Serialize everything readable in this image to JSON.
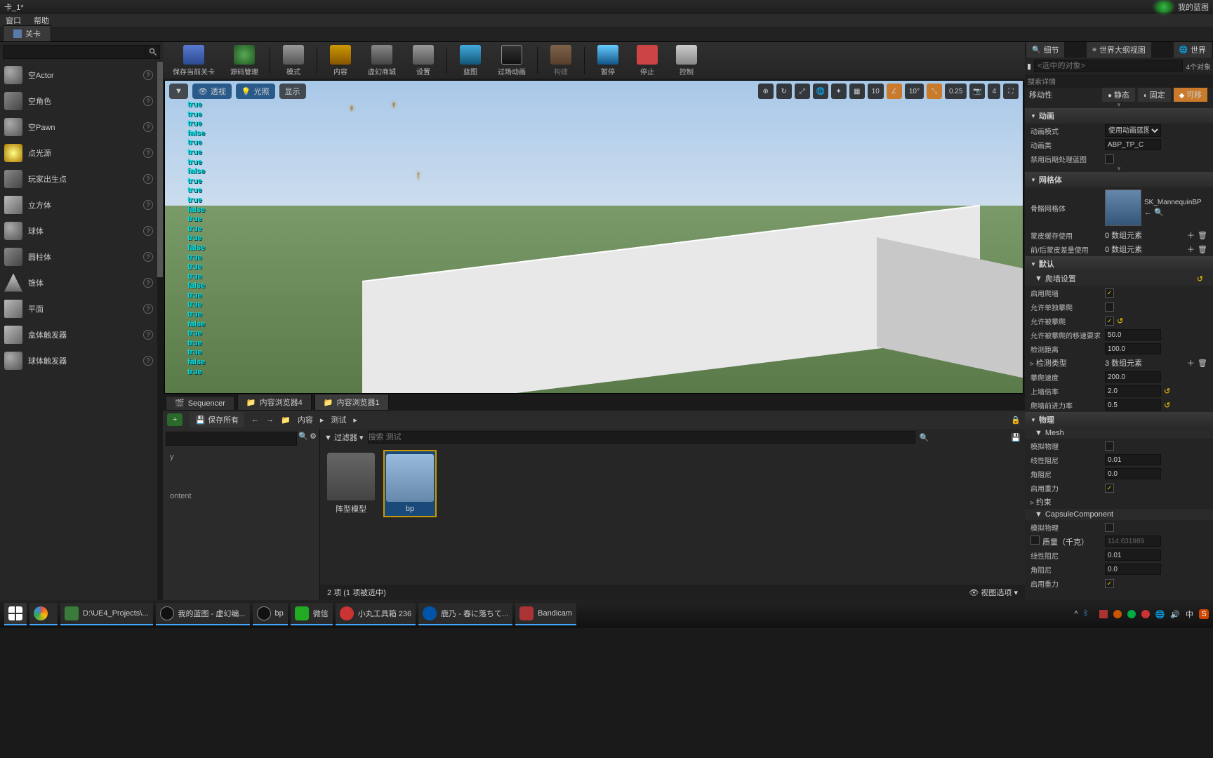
{
  "title": {
    "text": "卡_1*",
    "project": "我的蓝图"
  },
  "menu": {
    "window": "窗口",
    "help": "帮助"
  },
  "doc_tab": {
    "label": "关卡"
  },
  "toolbar": {
    "save": "保存当前关卡",
    "source": "源码管理",
    "mode": "模式",
    "content": "内容",
    "market": "虚幻商城",
    "settings": "设置",
    "blueprint": "蓝图",
    "cinematic": "过场动画",
    "build": "构建",
    "pause": "暂停",
    "stop": "停止",
    "eject": "控制"
  },
  "viewport": {
    "pills": {
      "dropdown": "▼",
      "persp": "透视",
      "lit": "光照",
      "show": "显示"
    },
    "snap": {
      "angle": "10°",
      "scale": "0.25",
      "cam": "4",
      "grid": "10"
    },
    "debug": [
      "true",
      "true",
      "true",
      "false",
      "true",
      "true",
      "true",
      "false",
      "true",
      "true",
      "true",
      "false",
      "true",
      "true",
      "true",
      "false",
      "true",
      "true",
      "true",
      "false",
      "true",
      "true",
      "true",
      "false",
      "true",
      "true",
      "true",
      "false",
      "true"
    ]
  },
  "place": {
    "items": [
      {
        "label": "空Actor"
      },
      {
        "label": "空角色"
      },
      {
        "label": "空Pawn"
      },
      {
        "label": "点光源"
      },
      {
        "label": "玩家出生点"
      },
      {
        "label": "立方体"
      },
      {
        "label": "球体"
      },
      {
        "label": "圆柱体"
      },
      {
        "label": "锥体"
      },
      {
        "label": "平面"
      },
      {
        "label": "盒体触发器"
      },
      {
        "label": "球体触发器"
      }
    ]
  },
  "bottom_tabs": {
    "t0": "Sequencer",
    "t1": "内容浏览器4",
    "t2": "内容浏览器1"
  },
  "cb": {
    "addnew": "+",
    "save_all": "保存所有",
    "path_root": "内容",
    "path_seg": "测试",
    "filter": "过滤器",
    "search_hint": "搜索 测试",
    "assets": [
      {
        "name": "阵型模型",
        "type": "folder"
      },
      {
        "name": "bp",
        "type": "bp"
      }
    ],
    "status": "2 项 (1 项被选中)",
    "view_opts": "视图选项",
    "tree_item": "ontent",
    "tree_item2": "y"
  },
  "right": {
    "tabs": {
      "details": "细节",
      "outliner": "世界大纲视图",
      "world": "世界"
    },
    "selected_hint": "<选中的对象>",
    "count": "4个对象",
    "search_hint": "搜索详情",
    "mobility": {
      "label": "移动性",
      "static": "静态",
      "fixed": "固定",
      "movable": "可移"
    },
    "cats": {
      "anim": "动画",
      "mesh_cat": "网格体",
      "default": "默认",
      "climb": "爬墙设置",
      "physics": "物理",
      "mesh_sub": "Mesh",
      "capsule": "CapsuleComponent",
      "constraint": "约束"
    },
    "props": {
      "anim_mode_l": "动画模式",
      "anim_mode_v": "使用动画蓝图",
      "anim_class_l": "动画类",
      "anim_class_v": "ABP_TP_C",
      "disable_pp_l": "禁用后期处理蓝图",
      "skm_l": "骨骼网格体",
      "skm_v": "SK_MannequinBP",
      "skin_l": "蒙皮缓存使用",
      "skin_v": "0 数组元素",
      "skin2_l": "前/后蒙皮差量使用",
      "skin2_v": "0 数组元素",
      "en_climb_l": "启用爬墙",
      "solo_l": "允许单独攀爬",
      "allow_l": "允许被攀爬",
      "speed_req_l": "允许被攀爬的移速要求",
      "speed_req_v": "50.0",
      "detect_l": "检测距离",
      "detect_v": "100.0",
      "detect_type_l": "检测类型",
      "detect_type_v": "3 数组元素",
      "climb_speed_l": "攀爬速度",
      "climb_speed_v": "200.0",
      "wall_rate_l": "上墙倍率",
      "wall_rate_v": "2.0",
      "forward_l": "爬墙前进力率",
      "forward_v": "0.5",
      "sim_l": "模拟物理",
      "lin_l": "线性阻尼",
      "lin_v": "0.01",
      "ang_l": "角阻尼",
      "ang_v": "0.0",
      "grav_l": "启用重力",
      "mass_l": "质量（千克）",
      "mass_v": "114.631989"
    }
  },
  "taskbar": {
    "items": [
      {
        "label": "",
        "color": "#333"
      },
      {
        "label": "",
        "color": "#1a7a44"
      },
      {
        "label": "D:\\UE4_Projects\\...",
        "color": "#3a7a3a"
      },
      {
        "label": "我的蓝图 - 虚幻编...",
        "color": "#111"
      },
      {
        "label": "bp",
        "color": "#111"
      },
      {
        "label": "微信",
        "color": "#2a2"
      },
      {
        "label": "小丸工具箱 236",
        "color": "#c33"
      },
      {
        "label": "鹿乃 - 春に落ちて...",
        "color": "#05a"
      },
      {
        "label": "Bandicam",
        "color": "#a33"
      }
    ]
  }
}
